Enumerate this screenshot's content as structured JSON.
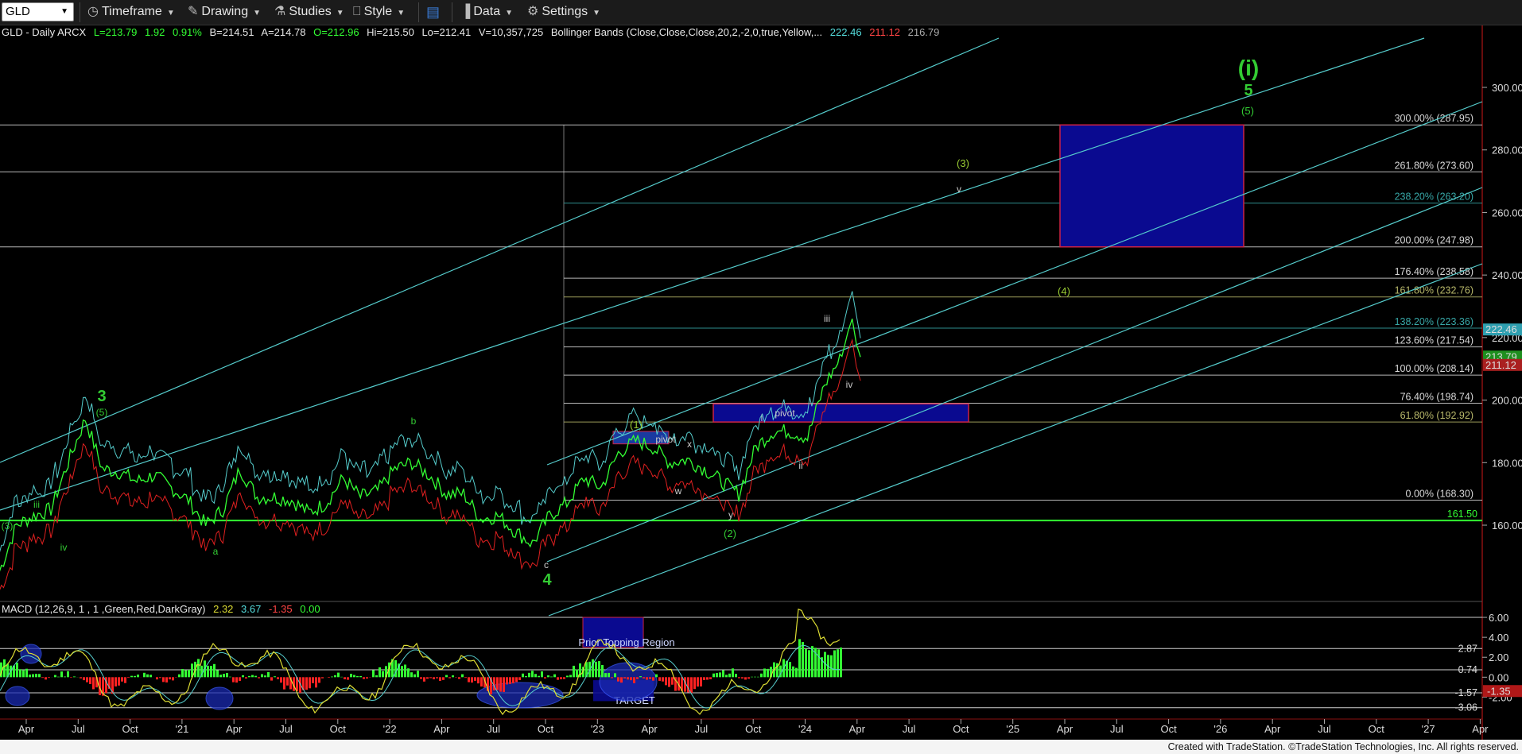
{
  "toolbar": {
    "symbol": "GLD",
    "items": [
      {
        "name": "timeframe",
        "label": "Timeframe",
        "icon": "clock-icon",
        "glyph": "◷",
        "x": 110
      },
      {
        "name": "drawing",
        "label": "Drawing",
        "icon": "pencil-icon",
        "glyph": "✎",
        "x": 236
      },
      {
        "name": "studies",
        "label": "Studies",
        "icon": "flask-icon",
        "glyph": "⚗",
        "x": 345
      },
      {
        "name": "style",
        "label": "Style",
        "icon": "style-icon",
        "glyph": "⎕",
        "x": 444
      },
      {
        "name": "data",
        "label": "Data",
        "icon": "bar-chart-icon",
        "glyph": "▐",
        "x": 580
      },
      {
        "name": "settings",
        "label": "Settings",
        "icon": "gear-icon",
        "glyph": "⚙",
        "x": 663
      }
    ],
    "layout_icon": "layout-icon"
  },
  "info": {
    "title": "GLD - Daily ARCX",
    "last": "L=213.79",
    "change": "1.92",
    "pct": "0.91%",
    "bid": "B=214.51",
    "ask": "A=214.78",
    "open": "O=212.96",
    "high": "Hi=215.50",
    "low": "Lo=212.41",
    "volume": "V=10,357,725",
    "bb_label": "Bollinger Bands (Close,Close,Close,20,2,-2,0,true,Yellow,...",
    "bb_upper": "222.46",
    "bb_lower": "211.12",
    "bb_mid": "216.79"
  },
  "macd_info": {
    "label": "MACD (12,26,9, 1 , 1 ,Green,Red,DarkGray)",
    "macd": "2.32",
    "signal": "3.67",
    "hist": "-1.35",
    "zero": "0.00"
  },
  "colors": {
    "up": "#33ff33",
    "down": "#ff2222",
    "cyan": "#55cccc",
    "yellow": "#dddd33",
    "navy": "#0a0a90",
    "wave_green": "#33cc33",
    "fib_white": "#cfcfcf"
  },
  "chart_data": {
    "type": "line",
    "series": [
      {
        "x": [
          "2020-03",
          "2020-04",
          "2020-05",
          "2020-06",
          "2020-07",
          "2020-08",
          "2020-09",
          "2020-10",
          "2020-11",
          "2020-12",
          "2021-01",
          "2021-02",
          "2021-03",
          "2021-04",
          "2021-05",
          "2021-06",
          "2021-07",
          "2021-08",
          "2021-09",
          "2021-10",
          "2021-11",
          "2021-12",
          "2022-01",
          "2022-02",
          "2022-03",
          "2022-04",
          "2022-05",
          "2022-06",
          "2022-07",
          "2022-08",
          "2022-09",
          "2022-10",
          "2022-11",
          "2022-12",
          "2023-01",
          "2023-02",
          "2023-03",
          "2023-04",
          "2023-05",
          "2023-06",
          "2023-07",
          "2023-08",
          "2023-09",
          "2023-10",
          "2023-11",
          "2023-12",
          "2024-01",
          "2024-02",
          "2024-03",
          "2024-04"
        ],
        "values": [
          145,
          160,
          163,
          165,
          180,
          194,
          178,
          177,
          174,
          176,
          172,
          168,
          160,
          165,
          178,
          169,
          169,
          168,
          164,
          167,
          175,
          169,
          171,
          178,
          180,
          176,
          170,
          170,
          162,
          163,
          158,
          154,
          163,
          167,
          175,
          172,
          183,
          187,
          185,
          180,
          181,
          178,
          174,
          170,
          185,
          190,
          190,
          188,
          205,
          214
        ]
      }
    ],
    "y_axis": {
      "ticks": [
        160,
        180,
        200,
        220,
        240,
        260,
        280,
        300
      ],
      "ylim": [
        140,
        318
      ]
    },
    "x_axis": {
      "ticks": [
        "Apr",
        "Jul",
        "Oct",
        "'21",
        "Apr",
        "Jul",
        "Oct",
        "'22",
        "Apr",
        "Jul",
        "Oct",
        "'23",
        "Apr",
        "Jul",
        "Oct",
        "'24",
        "Apr",
        "Jul",
        "Oct",
        "'25",
        "Apr",
        "Jul",
        "Oct",
        "'26",
        "Apr",
        "Jul",
        "Oct",
        "'27",
        "Apr"
      ]
    },
    "price_badges": [
      {
        "value": "222.46",
        "color": "#2e9fb0"
      },
      {
        "value": "213.79",
        "color": "#1e8f1e"
      },
      {
        "value": "211.12",
        "color": "#aa2020"
      }
    ],
    "support_label": "161.50",
    "fib_levels": [
      {
        "pct": "300.00%",
        "price": "(287.95)",
        "level": 288,
        "color": "#d8d8d8"
      },
      {
        "pct": "261.80%",
        "price": "(273.60)",
        "level": 273,
        "color": "#d8d8d8"
      },
      {
        "pct": "238.20%",
        "price": "(263.20)",
        "level": 263,
        "color": "#37a7a7"
      },
      {
        "pct": "200.00%",
        "price": "(247.98)",
        "level": 249,
        "color": "#d8d8d8"
      },
      {
        "pct": "176.40%",
        "price": "(238.58)",
        "level": 239,
        "color": "#d8d8d8"
      },
      {
        "pct": "161.80%",
        "price": "(232.76)",
        "level": 233,
        "color": "#b8b86a"
      },
      {
        "pct": "138.20%",
        "price": "(223.36)",
        "level": 223,
        "color": "#37a7a7"
      },
      {
        "pct": "123.60%",
        "price": "(217.54)",
        "level": 217,
        "color": "#d8d8d8"
      },
      {
        "pct": "100.00%",
        "price": "(208.14)",
        "level": 208,
        "color": "#d8d8d8"
      },
      {
        "pct": "76.40%",
        "price": "(198.74)",
        "level": 199,
        "color": "#d8d8d8"
      },
      {
        "pct": "61.80%",
        "price": "(192.92)",
        "level": 193,
        "color": "#b8b86a"
      },
      {
        "pct": "0.00%",
        "price": "(168.30)",
        "level": 168,
        "color": "#d8d8d8"
      }
    ],
    "wave_labels": [
      {
        "text": "(i)",
        "color": "#33cc33",
        "size": 28
      },
      {
        "text": "5",
        "color": "#33cc33",
        "size": 20
      },
      {
        "text": "(5)",
        "color": "#33cc33",
        "size": 13
      },
      {
        "text": "(3)",
        "color": "#99cc33",
        "size": 13
      },
      {
        "text": "v",
        "color": "#cccccc",
        "size": 12
      },
      {
        "text": "(4)",
        "color": "#99cc33",
        "size": 13
      },
      {
        "text": "iii",
        "color": "#cccccc",
        "size": 12
      },
      {
        "text": "iv",
        "color": "#cccccc",
        "size": 12
      },
      {
        "text": "i",
        "color": "#cccccc",
        "size": 12
      },
      {
        "text": "pivot",
        "color": "#cccccc",
        "size": 12
      },
      {
        "text": "ii",
        "color": "#cccccc",
        "size": 12
      },
      {
        "text": "(1)",
        "color": "#99cc33",
        "size": 13
      },
      {
        "text": "pivot",
        "color": "#cccccc",
        "size": 12
      },
      {
        "text": "x",
        "color": "#cccccc",
        "size": 12
      },
      {
        "text": "w",
        "color": "#cccccc",
        "size": 12
      },
      {
        "text": "y",
        "color": "#cccccc",
        "size": 12
      },
      {
        "text": "(2)",
        "color": "#33cc33",
        "size": 13
      },
      {
        "text": "3",
        "color": "#33cc33",
        "size": 20
      },
      {
        "text": "(5)",
        "color": "#33cc33",
        "size": 12
      },
      {
        "text": "iii",
        "color": "#33cc33",
        "size": 12
      },
      {
        "text": "iv",
        "color": "#33cc33",
        "size": 12
      },
      {
        "text": "a",
        "color": "#33cc33",
        "size": 12
      },
      {
        "text": "b",
        "color": "#33cc33",
        "size": 12
      },
      {
        "text": "c",
        "color": "#cccccc",
        "size": 12
      },
      {
        "text": "4",
        "color": "#33cc33",
        "size": 20
      },
      {
        "text": "(3)",
        "color": "#33cc33",
        "size": 12
      }
    ],
    "macd_axis": {
      "ticks": [
        "6.00",
        "4.00",
        "2.00",
        "0.00",
        "-2.00"
      ],
      "ylim": [
        -3.8,
        6.8
      ]
    },
    "macd_levels": [
      {
        "label": "2.87",
        "level": 2.87
      },
      {
        "label": "0.74",
        "level": 0.74
      },
      {
        "label": "-1.57",
        "level": -1.57
      },
      {
        "label": "-3.06",
        "level": -3.06
      }
    ],
    "macd_badge": "-1.35",
    "annotations": {
      "prior_topping": "Prior Topping Region",
      "target": "TARGET"
    }
  },
  "footer": "Created with TradeStation. ©TradeStation Technologies, Inc. All rights reserved."
}
